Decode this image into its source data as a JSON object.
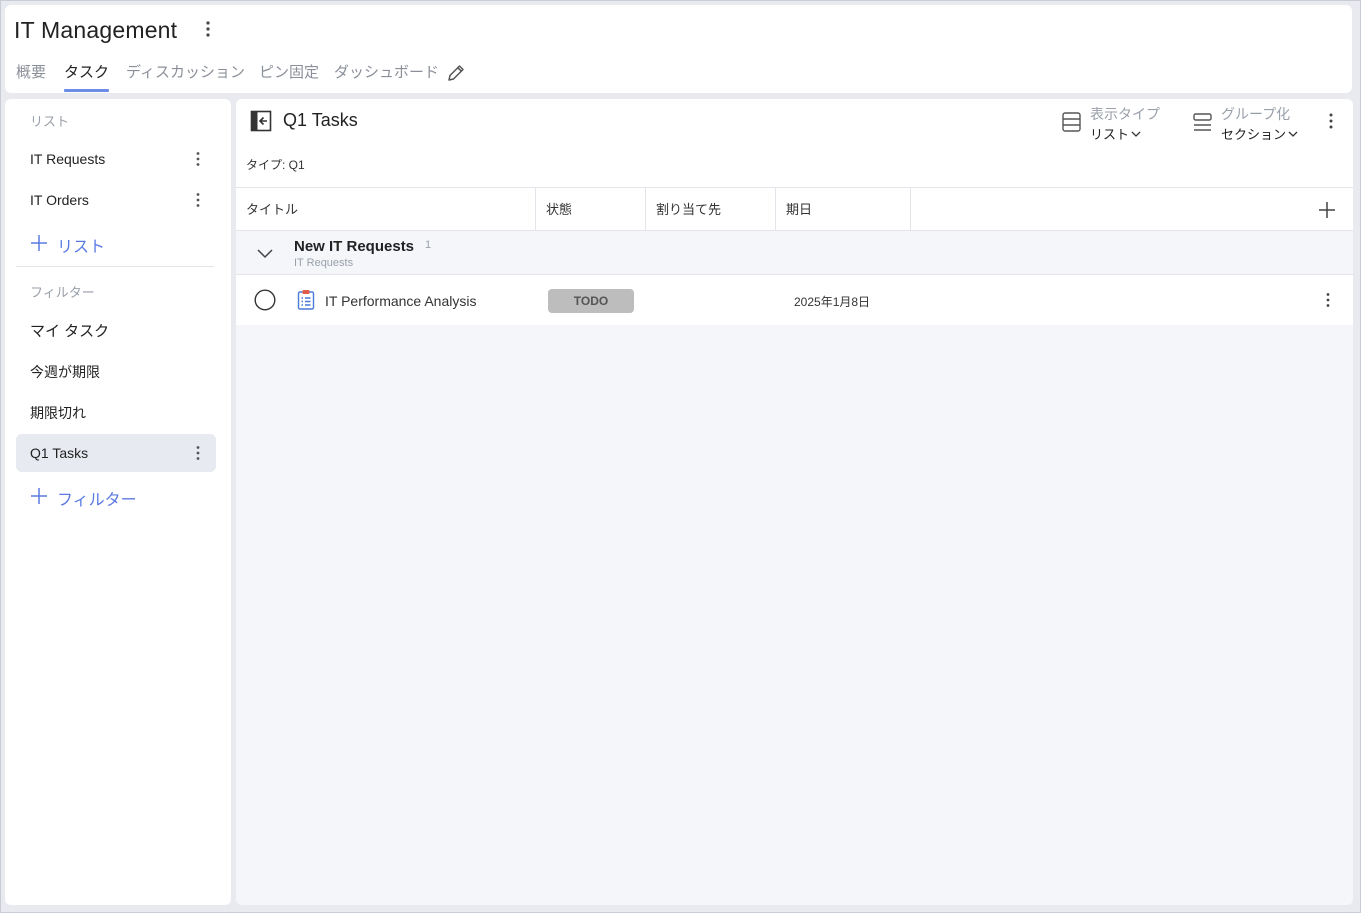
{
  "header": {
    "app_title": "IT Management",
    "tabs": [
      {
        "label": "概要"
      },
      {
        "label": "タスク"
      },
      {
        "label": "ディスカッション"
      },
      {
        "label": "ピン固定"
      },
      {
        "label": "ダッシュボード"
      }
    ],
    "active_tab": "タスク"
  },
  "sidebar": {
    "lists_label": "リスト",
    "lists": [
      {
        "label": "IT Requests"
      },
      {
        "label": "IT Orders"
      }
    ],
    "add_list_label": "リスト",
    "filters_label": "フィルター",
    "filters": [
      {
        "label": "マイ タスク"
      },
      {
        "label": "今週が期限"
      },
      {
        "label": "期限切れ"
      },
      {
        "label": "Q1 Tasks"
      }
    ],
    "active_filter": "Q1 Tasks",
    "add_filter_label": "フィルター"
  },
  "main": {
    "title": "Q1 Tasks",
    "type_label": "タイプ: Q1",
    "view_type": {
      "label": "表示タイプ",
      "value": "リスト"
    },
    "group_by": {
      "label": "グループ化",
      "value": "セクション"
    },
    "columns": [
      {
        "label": "タイトル"
      },
      {
        "label": "状態"
      },
      {
        "label": "割り当て先"
      },
      {
        "label": "期日"
      }
    ],
    "group": {
      "title": "New IT Requests",
      "count": "1",
      "subtitle": "IT Requests"
    },
    "tasks": [
      {
        "title": "IT Performance Analysis",
        "status": "TODO",
        "assignee": "",
        "due": "2025年1月8日"
      }
    ]
  },
  "colors": {
    "accent": "#6f8be8",
    "link": "#5b7be0",
    "status_todo_bg": "#bdbdbd",
    "task_icon": "#4a79d8",
    "task_icon_top": "#e25c4b"
  },
  "icons": {
    "title_menu": "kebab-icon",
    "tab_edit": "pencil-icon",
    "collapse": "collapse-sidebar-icon",
    "view_type": "list-view-icon",
    "group_by": "group-icon",
    "add_column": "plus-icon",
    "group_toggle": "chevron-down-icon",
    "task_check": "circle-icon",
    "task_type": "clipboard-checklist-icon"
  }
}
